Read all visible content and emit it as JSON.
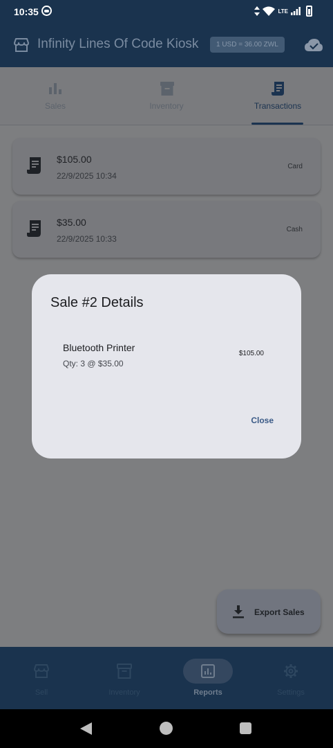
{
  "status_bar": {
    "time": "10:35",
    "network": "LTE"
  },
  "app_bar": {
    "title": "Infinity Lines Of Code Kiosk",
    "exchange_rate": "1 USD = 36.00 ZWL",
    "icons": {
      "store": "storefront-icon",
      "sync": "cloud-done-icon"
    }
  },
  "tabs": [
    {
      "label": "Sales",
      "icon": "bar-chart-icon",
      "active": false
    },
    {
      "label": "Inventory",
      "icon": "archive-box-icon",
      "active": false
    },
    {
      "label": "Transactions",
      "icon": "receipt-icon",
      "active": true
    }
  ],
  "transactions": [
    {
      "amount": "$105.00",
      "date": "22/9/2025 10:34",
      "method": "Card"
    },
    {
      "amount": "$35.00",
      "date": "22/9/2025 10:33",
      "method": "Cash"
    }
  ],
  "fab": {
    "label": "Export Sales",
    "icon": "download-icon"
  },
  "bottom_nav": [
    {
      "label": "Sell",
      "icon": "storefront-icon",
      "active": false
    },
    {
      "label": "Inventory",
      "icon": "archive-box-icon",
      "active": false
    },
    {
      "label": "Reports",
      "icon": "analytics-icon",
      "active": true
    },
    {
      "label": "Settings",
      "icon": "gear-icon",
      "active": false
    }
  ],
  "dialog": {
    "title": "Sale #2 Details",
    "item_name": "Bluetooth Printer",
    "item_qty": "Qty: 3 @ $35.00",
    "item_total": "$105.00",
    "close_label": "Close"
  },
  "colors": {
    "primary": "#1a334e",
    "accent_text": "#3a5a86",
    "dialog_bg": "#e5e6ec",
    "scrim_bg": "#7d7e80"
  }
}
